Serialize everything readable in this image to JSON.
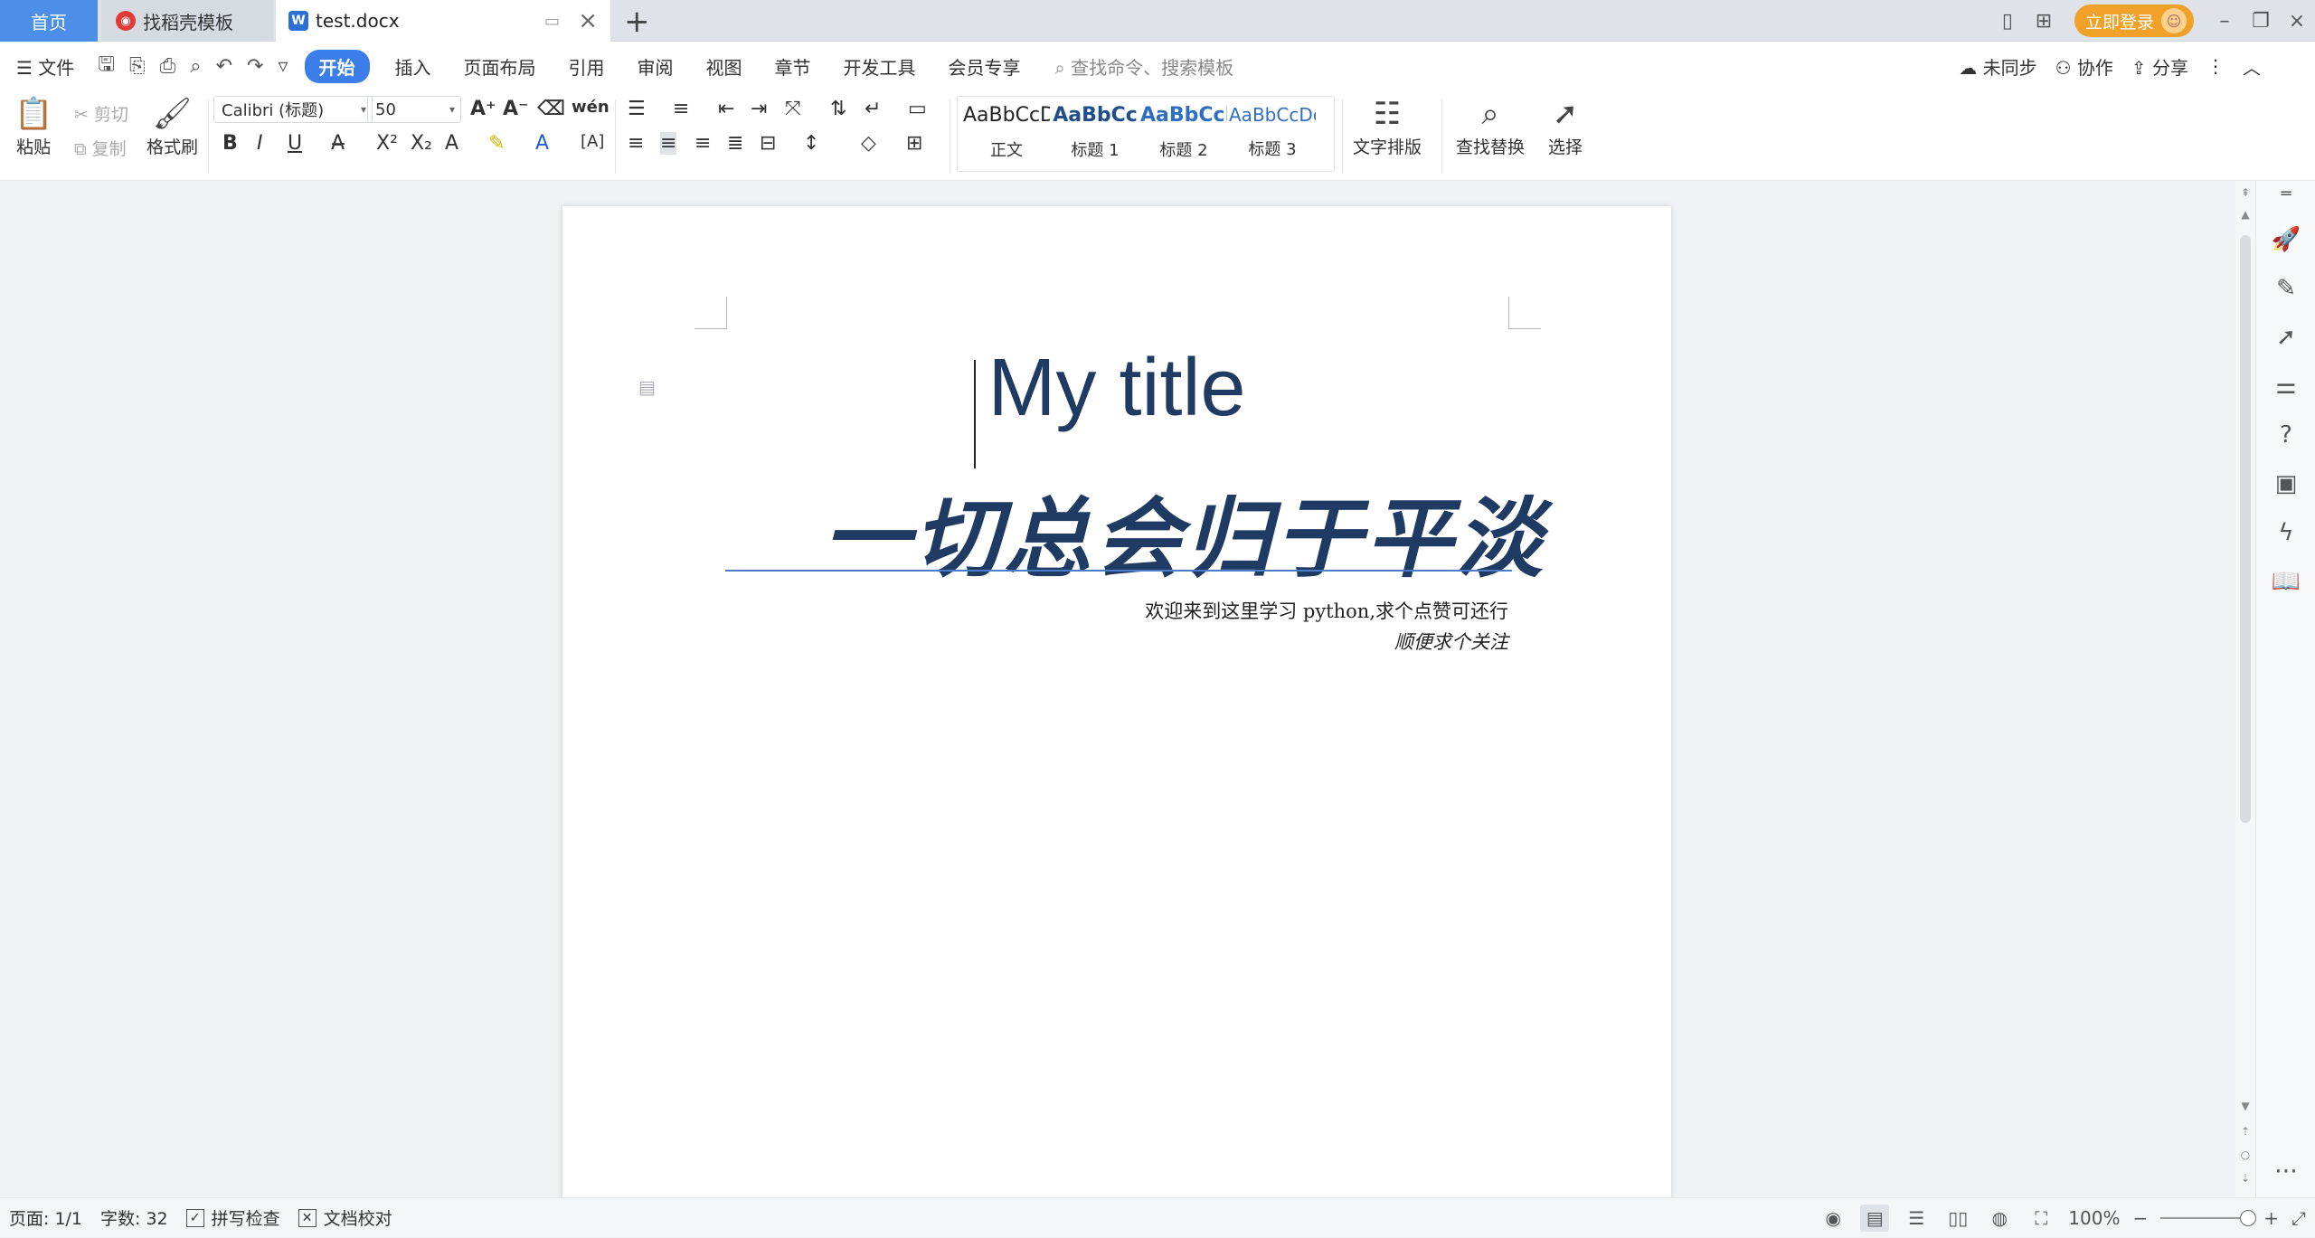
{
  "tabs": {
    "home": "首页",
    "daoke": "找稻壳模板",
    "doc": "test.docx",
    "add": "+"
  },
  "titlebar": {
    "login": "立即登录"
  },
  "menu": {
    "file": "文件",
    "items": [
      "开始",
      "插入",
      "页面布局",
      "引用",
      "审阅",
      "视图",
      "章节",
      "开发工具",
      "会员专享"
    ],
    "search": "查找命令、搜索模板",
    "sync": "未同步",
    "collab": "协作",
    "share": "分享"
  },
  "ribbon": {
    "paste": "粘贴",
    "cut": "剪切",
    "copy": "复制",
    "format_painter": "格式刷",
    "font_name": "Calibri (标题)",
    "font_size": "50",
    "styles": [
      {
        "sample": "AaBbCcDd",
        "label": "正文"
      },
      {
        "sample": "AaBbCc",
        "label": "标题 1"
      },
      {
        "sample": "AaBbCcI",
        "label": "标题 2"
      },
      {
        "sample": "AaBbCcDc",
        "label": "标题 3"
      }
    ],
    "text_layout": "文字排版",
    "find_replace": "查找替换",
    "select": "选择"
  },
  "document": {
    "title": "My title",
    "subtitle": "一切总会归于平淡",
    "line1": "欢迎来到这里学习 python,求个点赞可还行",
    "line2": "顺便求个关注"
  },
  "status": {
    "page": "页面: 1/1",
    "words": "字数: 32",
    "spellcheck": "拼写检查",
    "proofread": "文档校对",
    "zoom": "100%"
  },
  "colors": {
    "accent": "#3b7de9",
    "title_text": "#1f3b63",
    "login": "#f0a12a"
  }
}
